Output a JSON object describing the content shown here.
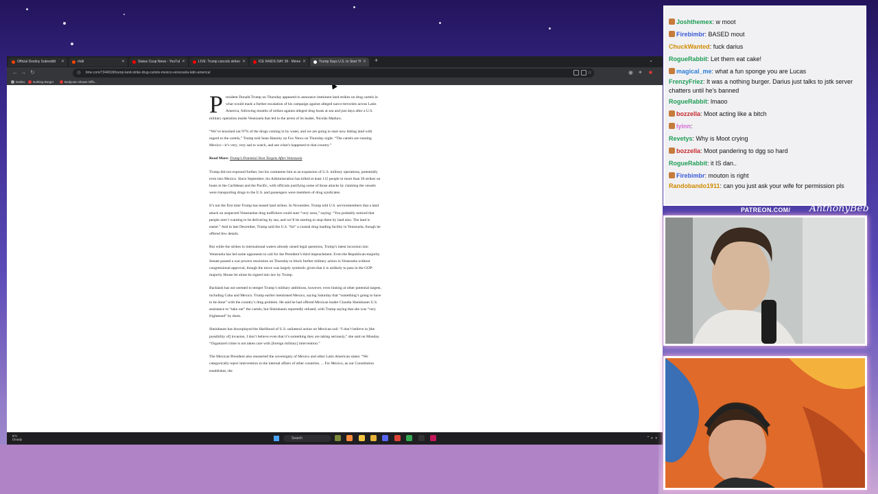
{
  "browser": {
    "tabs": [
      {
        "label": "Official Destiny Subreddit",
        "color": "#ff4500"
      },
      {
        "label": "r/stil",
        "color": "#ff4500"
      },
      {
        "label": "Status Coup News - YouTube",
        "color": "#ff0000"
      },
      {
        "label": "LIVE: Trump cancels strikes on V",
        "color": "#ff0000"
      },
      {
        "label": "ICE RAIDS DAY 39 - Minneapo",
        "color": "#ff0000"
      },
      {
        "label": "Trump Says U.S. to Start 'Hitting",
        "color": "#ffffff",
        "active": true
      }
    ],
    "new_tab": "+",
    "url": "time.com/7344918/trump-land-strike-drug-cartels-mexico-venezuela-latin-america/",
    "bookmarks": [
      {
        "label": "Dailies",
        "color": "#aaaaaa"
      },
      {
        "label": "Nothing Burger",
        "color": "#e53935"
      },
      {
        "label": "Bodycam Shows Offic...",
        "color": "#e53935"
      }
    ]
  },
  "article": {
    "dropcap": "P",
    "paragraphs": [
      "resident Donald Trump on Thursday appeared to announce imminent land strikes on drug cartels in what would mark a further escalation of his campaign against alleged narco-terrorists across Latin America, following months of strikes against alleged drug boats at sea and just days after a U.S. military operation inside Venezuela that led to the arrest of its leader, Nicolás Maduro.",
      "“We’ve knocked out 97% of the drugs coming in by water, and we are going to start now hitting land with regard to the cartels,” Trump told Sean Hannity on Fox News on Thursday night. “The cartels are running Mexico—it’s very, very sad to watch, and see what’s happened to that country.”",
      "Trump did not expound further, but his comments hint at an expansion of U.S. military operations, potentially even into Mexico. Since September, his Administration has killed at least 115 people in more than 30 strikes on boats in the Caribbean and the Pacific, with officials justifying some of those attacks by claiming the vessels were transporting drugs to the U.S. and passengers were members of drug syndicates.",
      "It’s not the first time Trump has teased land strikes. In November, Trump told U.S. servicemembers that a land attack on suspected Venezuelan drug traffickers could start “very soon,” saying: “You probably noticed that people aren’t wanting to be delivering by sea, and we’ll be starting to stop them by land also. The land is easier.” And in late December, Trump said the U.S. “hit” a coastal drug loading facility in Venezuela, though he offered few details.",
      "But while the strikes in international waters already raised legal questions, Trump’s latest incursion into Venezuela has led some opponents to call for the President’s third impeachment. Even the Republican-majority Senate passed a war powers resolution on Thursday to block further military action in Venezuela without congressional approval, though the move was largely symbolic given that it is unlikely to pass in the GOP-majority House let alone be signed into law by Trump.",
      "Backlash has not seemed to temper Trump’s military ambitions, however, even hinting at other potential targets, including Cuba and Mexico. Trump earlier mentioned Mexico, saying Saturday that “something’s going to have to be done” with the country’s drug problem. He said he had offered Mexican leader Claudia Sheinbaum U.S. assistance to “take out” the cartels, but Sheinbaum reportedly refused, with Trump saying that she was “very frightened” by them.",
      "Sheinbaum has downplayed the likelihood of U.S. unilateral action on Mexican soil. “I don’t believe in [the possibility of] invasion, I don’t believe even that it’s something they are taking seriously,” she said on Monday. “Organized crime is not taken care with [foreign military] intervention.”",
      "The Mexican President also reasserted the sovereignty of Mexico and other Latin American states: “We categorically reject intervention in the internal affairs of other countries. ... For Mexico, as our Constitution establishes, the"
    ],
    "read_more_label": "Read More:",
    "read_more_link": "Trump’s Potential Next Targets After Venezuela"
  },
  "taskbar": {
    "weather_temp": "8°C",
    "weather_desc": "Cloudy",
    "search_placeholder": "Search"
  },
  "chat": {
    "messages": [
      {
        "user": "Joshthemex",
        "text": "w moot",
        "color": "#1f9d55",
        "badge": true
      },
      {
        "user": "Firebimbr",
        "text": "BASED mout",
        "color": "#3b5bd6",
        "badge": true
      },
      {
        "user": "ChuckWanted",
        "text": "fuck darius",
        "color": "#d08a00"
      },
      {
        "user": "RogueRabbit",
        "text": "Let them eat cake!",
        "color": "#1f9d55"
      },
      {
        "user": "magical_me",
        "text": "what a fun sponge you are Lucas",
        "color": "#2a7bd4",
        "badge": true
      },
      {
        "user": "FrenzyFriez",
        "text": "It was a nothing burger. Darius just talks to jstk server chatters until he's banned",
        "color": "#1f9d55",
        "wrap": true
      },
      {
        "user": "RogueRabbit",
        "text": "lmaoo",
        "color": "#1f9d55"
      },
      {
        "user": "bozzella",
        "text": "Moot acting like a bitch",
        "color": "#c62828",
        "badge": true
      },
      {
        "user": "lyinn",
        "text": "",
        "color": "#d46bd4",
        "badge": true
      },
      {
        "user": "Revetys",
        "text": "Why is Moot crying",
        "color": "#1f9d55"
      },
      {
        "user": "bozzella",
        "text": "Moot pandering to dgg so hard",
        "color": "#c62828",
        "badge": true
      },
      {
        "user": "RogueRabbit",
        "text": "it IS dan..",
        "color": "#1f9d55"
      },
      {
        "user": "Firebimbr",
        "text": "mouton is right",
        "color": "#3b5bd6",
        "badge": true
      },
      {
        "user": "Randobando1911",
        "text": "can you just ask your wife for permission pls",
        "color": "#d08a00",
        "wrap": true
      }
    ]
  },
  "overlay": {
    "patreon": "PATREON.COM/",
    "signature": "AnthonyBeb"
  }
}
